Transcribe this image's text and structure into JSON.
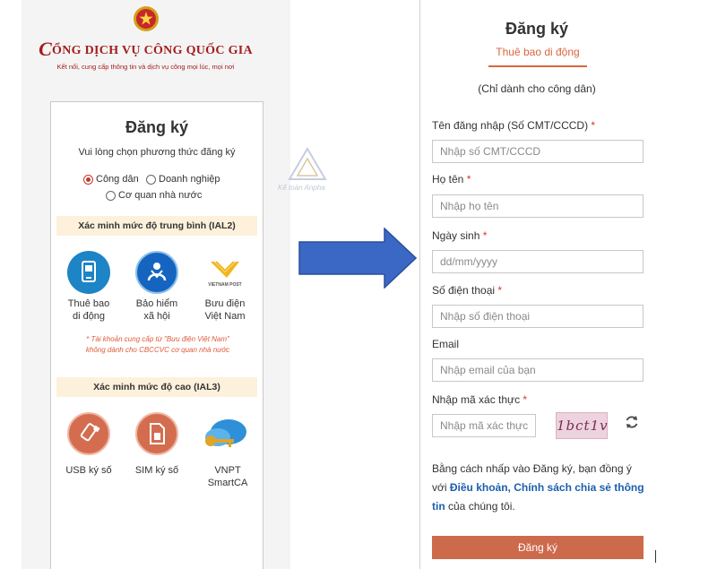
{
  "portal": {
    "title_first_letter": "C",
    "title_rest": "ỔNG DỊCH VỤ CÔNG QUỐC GIA",
    "subtitle": "Kết nối, cung cấp thông tin và dịch vụ công mọi lúc, mọi nơi"
  },
  "left_card": {
    "title": "Đăng ký",
    "subtitle": "Vui lòng chọn phương thức đăng ký",
    "radios": [
      {
        "label": "Công dân",
        "checked": true
      },
      {
        "label": "Doanh nghiệp",
        "checked": false
      },
      {
        "label": "Cơ quan nhà nước",
        "checked": false
      }
    ],
    "ial2_heading": "Xác minh mức độ trung bình (IAL2)",
    "ial2_options": [
      {
        "line1": "Thuê bao",
        "line2": "di động",
        "icon": "mobile-subscriber-icon"
      },
      {
        "line1": "Bảo hiểm",
        "line2": "xã hội",
        "icon": "social-insurance-logo-icon"
      },
      {
        "line1": "Bưu điện",
        "line2": "Việt Nam",
        "icon": "vietnam-post-logo-icon",
        "logo_text": "VIETNAM POST"
      }
    ],
    "note_line1": "* Tài khoản cung cấp từ \"Bưu điện Việt Nam\"",
    "note_line2": "không dành cho CBCCVC cơ quan nhà nước",
    "ial3_heading": "Xác minh mức độ cao (IAL3)",
    "ial3_options": [
      {
        "label": "USB ký số",
        "icon": "usb-token-icon"
      },
      {
        "label": "SIM ký số",
        "icon": "sim-card-icon"
      },
      {
        "label": "VNPT SmartCA",
        "icon": "vnpt-smartca-icon"
      }
    ]
  },
  "watermark": {
    "text": "Kế toán Anpha"
  },
  "form": {
    "title": "Đăng ký",
    "tab": "Thuê bao di động",
    "note": "(Chỉ dành cho công dân)",
    "fields": [
      {
        "label": "Tên đăng nhập (Số CMT/CCCD)",
        "required": "*",
        "placeholder": "Nhập số CMT/CCCD"
      },
      {
        "label": "Họ tên",
        "required": "*",
        "placeholder": "Nhập họ tên"
      },
      {
        "label": "Ngày sinh",
        "required": "*",
        "placeholder": "dd/mm/yyyy"
      },
      {
        "label": "Số điện thoại",
        "required": "*",
        "placeholder": "Nhập số điện thoại"
      },
      {
        "label": "Email",
        "required": "",
        "placeholder": "Nhập email của bạn"
      }
    ],
    "captcha": {
      "label": "Nhập mã xác thực",
      "required": "*",
      "placeholder": "Nhập mã xác thực",
      "image_text": "1bct1v"
    },
    "terms": {
      "prefix": "Bằng cách nhấp vào Đăng ký, bạn đồng ý với ",
      "link": "Điều khoản, Chính sách chia sẻ thông tin",
      "suffix": " của chúng tôi."
    },
    "submit_label": "Đăng ký"
  },
  "colors": {
    "brand_red": "#a31d1d",
    "accent_orange": "#d9663f",
    "button": "#cd6a4c",
    "arrow": "#3a68c4",
    "link": "#1b5fae"
  }
}
